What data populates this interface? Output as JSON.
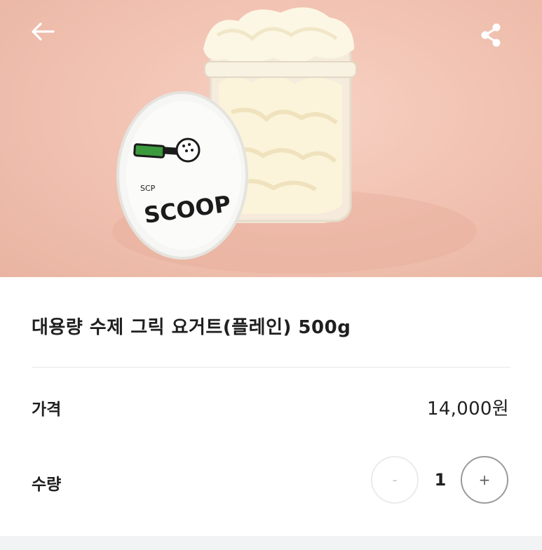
{
  "header": {
    "back_icon": "arrow-left-icon",
    "share_icon": "share-icon",
    "hero_image": "product-photo-greek-yogurt-jar"
  },
  "product": {
    "title": "대용량 수제 그릭 요거트(플레인) 500g",
    "brand_lid_small": "SCP",
    "brand_lid": "SCOOP"
  },
  "price": {
    "label": "가격",
    "value": "14,000원"
  },
  "quantity": {
    "label": "수량",
    "value": "1",
    "minus_label": "-",
    "plus_label": "+"
  },
  "colors": {
    "hero_background": "#f2c3b3",
    "text_primary": "#1f1f1f",
    "divider": "#e8e8e8",
    "bottom_bar": "#f2f3f5"
  }
}
